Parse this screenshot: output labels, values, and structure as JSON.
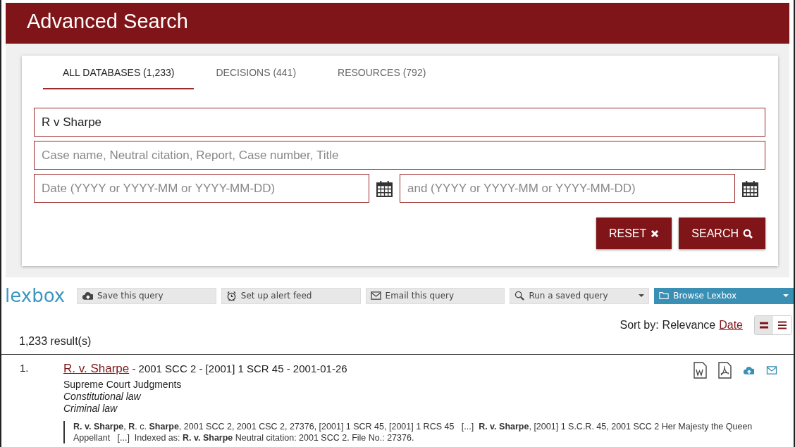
{
  "header": {
    "title": "Advanced Search"
  },
  "tabs": [
    {
      "label": "ALL DATABASES (1,233)",
      "selected": true
    },
    {
      "label": "DECISIONS (441)",
      "selected": false
    },
    {
      "label": "RESOURCES (792)",
      "selected": false
    }
  ],
  "fields": [
    {
      "value": "R v Sharpe"
    },
    {
      "placeholder": "Case name, Neutral citation, Report, Case number, Title"
    }
  ],
  "date_fields": [
    {
      "placeholder": "Date (YYYY or YYYY-MM or YYYY-MM-DD)"
    },
    {
      "placeholder": "and (YYYY or YYYY-MM or YYYY-MM-DD)"
    }
  ],
  "buttons": [
    {
      "label": "RESET",
      "kind": "reset"
    },
    {
      "label": "SEARCH",
      "kind": "search"
    }
  ],
  "toolbar": {
    "logo": "lexbox",
    "actions": [
      {
        "label": "Save this query",
        "kind": "save"
      },
      {
        "label": "Set up alert feed",
        "kind": "alert"
      },
      {
        "label": "Email this query",
        "kind": "email"
      },
      {
        "label": "Run a saved query",
        "kind": "run"
      }
    ],
    "browse": {
      "label": "Browse Lexbox"
    }
  },
  "results_count": "1,233 result(s)",
  "sort": {
    "label": "Sort by:",
    "options": [
      {
        "label": "Relevance",
        "selected": true
      },
      {
        "label": "Date",
        "selected": false
      }
    ]
  },
  "view_modes": [
    {
      "kind": "compact",
      "selected": true
    },
    {
      "kind": "list",
      "selected": false
    }
  ],
  "results": [
    {
      "number": "1.",
      "title": "R. v. Sharpe",
      "citation": "- 2001 SCC 2 - [2001] 1 SCR 45 - 2001-01-26",
      "collection": "Supreme Court Judgments",
      "subjects": [
        "Constitutional law",
        "Criminal law"
      ],
      "snippet": "**R. v. Sharpe**, **R**. c. **Sharpe**, 2001 SCC 2, 2001 CSC 2, 27376, [2001] 1 SCR 45, [2001] 1 RCS 45   [...]  **R. v. Sharpe**, [2001] 1 S.C.R. 45, 2001 SCC 2 Her Majesty the Queen Appellant   [...]  Indexed as: **R. v. Sharpe** Neutral citation: 2001 SCC 2. File No.: 27376."
    }
  ]
}
